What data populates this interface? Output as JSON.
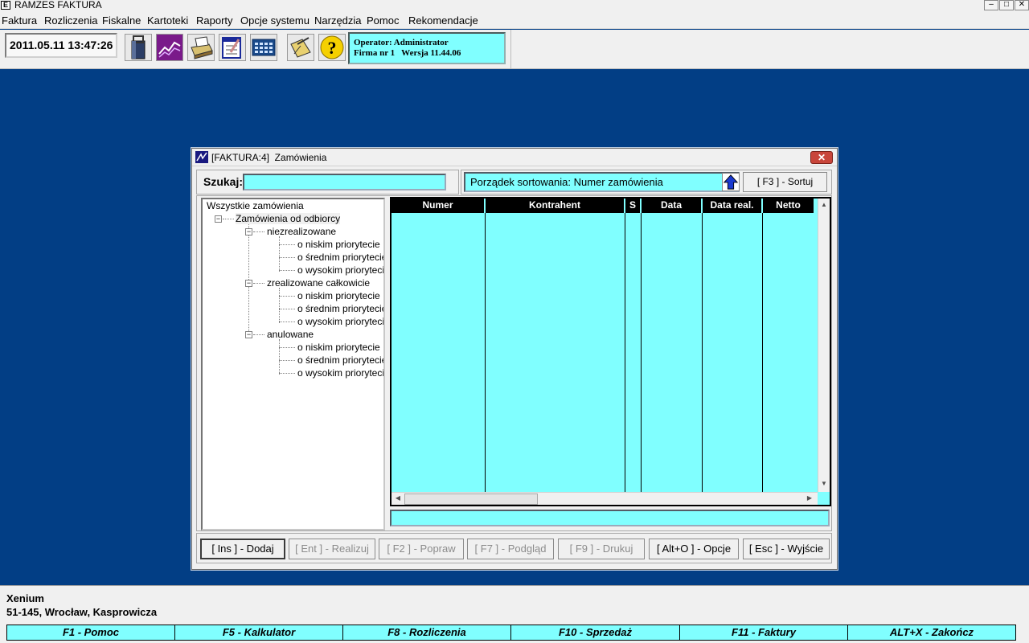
{
  "app": {
    "title": "RAMZES FAKTURA",
    "icon_letter": "E"
  },
  "window_controls": {
    "minimize": "–",
    "maximize": "□",
    "close": "✕"
  },
  "menu": [
    "Faktura",
    "Rozliczenia",
    "Fiskalne",
    "Kartoteki",
    "Raporty",
    "Opcje systemu",
    "Narzędzia",
    "Pomoc",
    "Rekomendacje"
  ],
  "toolbar": {
    "datetime": "2011.05.11 13:47:26",
    "icons": [
      "bag-icon",
      "chart-icon",
      "printer-icon",
      "checklist-icon",
      "calculator-icon",
      "notebook-icon",
      "help-icon"
    ],
    "operator_line": "Operator: Administrator",
    "firm_line": "Firma nr 1   Wersja 11.44.06"
  },
  "dialog": {
    "title": "[FAKTURA:4]  Zamówienia",
    "search_label": "Szukaj:",
    "search_value": "",
    "sort_text": "Porządek sortowania: Numer zamówienia",
    "sort_button": "[ F3 ] - Sortuj",
    "tree": {
      "root": "Wszystkie zamówienia",
      "level1": "Zamówienia od odbiorcy",
      "groups": [
        {
          "label": "niezrealizowane",
          "children": [
            "o niskim priorytecie",
            "o średnim priorytecie",
            "o wysokim priorytecie"
          ]
        },
        {
          "label": "zrealizowane całkowicie",
          "children": [
            "o niskim priorytecie",
            "o średnim priorytecie",
            "o wysokim priorytecie"
          ]
        },
        {
          "label": "anulowane",
          "children": [
            "o niskim priorytecie",
            "o średnim priorytecie",
            "o wysokim priorytecie"
          ]
        }
      ]
    },
    "table": {
      "columns": [
        "Numer",
        "Kontrahent",
        "S",
        "Data",
        "Data real.",
        "Netto"
      ],
      "rows": []
    },
    "buttons": [
      {
        "label": "[ Ins ] - Dodaj",
        "enabled": true
      },
      {
        "label": "[ Ent ] - Realizuj",
        "enabled": false
      },
      {
        "label": "[ F2 ] - Popraw",
        "enabled": false
      },
      {
        "label": "[ F7 ] - Podgląd",
        "enabled": false
      },
      {
        "label": "[ F9 ] - Drukuj",
        "enabled": false
      },
      {
        "label": "[ Alt+O ] - Opcje",
        "enabled": true
      },
      {
        "label": "[ Esc ] - Wyjście",
        "enabled": true
      }
    ]
  },
  "company": {
    "name": "Xenium",
    "address": "51-145, Wrocław, Kasprowicza"
  },
  "function_keys": [
    "F1 - Pomoc",
    "F5 - Kalkulator",
    "F8 - Rozliczenia",
    "F10 - Sprzedaż",
    "F11 - Faktury",
    "ALT+X - Zakończ"
  ],
  "colors": {
    "desktop": "#023e85",
    "field": "#80ffff",
    "header": "#000000"
  }
}
